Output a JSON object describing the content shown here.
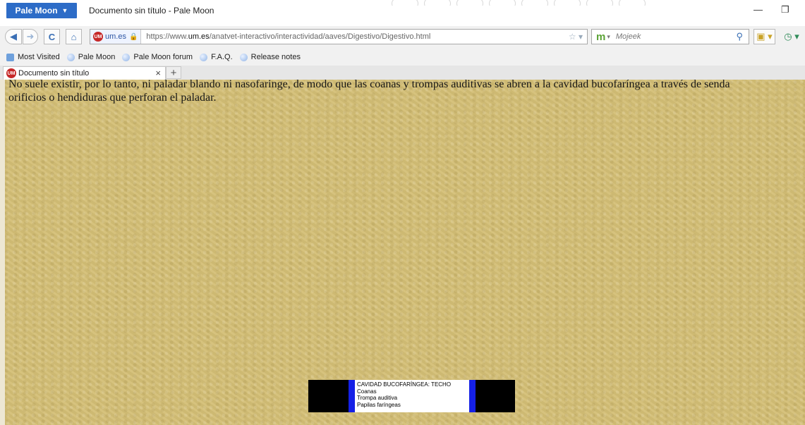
{
  "titlebar": {
    "app_button": "Pale Moon",
    "window_title": "Documento sin título - Pale Moon",
    "minimize": "—",
    "restore": "❐"
  },
  "navbar": {
    "back_icon": "back-arrow-icon",
    "forward_icon": "forward-arrow-icon",
    "reload_icon": "reload-icon",
    "home_icon": "home-icon",
    "site_identity": "um.es",
    "url_prefix": "https://www.",
    "url_host": "um.es",
    "url_path": "/anatvet-interactivo/interactividad/aaves/Digestivo/Digestivo.html",
    "search_placeholder": "Mojeek"
  },
  "bookmarks": [
    "Most Visited",
    "Pale Moon",
    "Pale Moon forum",
    "F.A.Q.",
    "Release notes"
  ],
  "tab": {
    "title": "Documento sin título",
    "close": "×",
    "new_tab": "+"
  },
  "content": {
    "line1": "No suele existir, por lo tanto, ni paladar blando ni nasofaringe, de modo que las coanas y trompas auditivas se abren a la cavidad bucofaríngea a través de senda",
    "line2": "orificios o hendiduras que perforan el paladar."
  },
  "legend": {
    "title": "CAVIDAD BUCOFARÍNGEA:  TECHO",
    "items": [
      "Coanas",
      "Trompa auditiva",
      "Papilas faríngeas"
    ]
  },
  "colors": {
    "app_button": "#2d6cc7",
    "content_bg": "#d4bf76",
    "legend_blue": "#1520e6"
  }
}
